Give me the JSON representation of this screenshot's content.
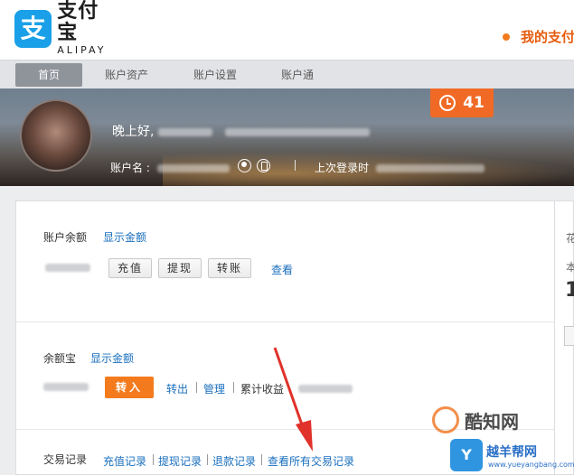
{
  "header": {
    "logo_cn": "支付宝",
    "logo_en": "ALIPAY",
    "logo_mark": "支",
    "my_link": "我的支付"
  },
  "nav": {
    "items": [
      {
        "label": "首页",
        "active": true
      },
      {
        "label": "账户资产",
        "active": false
      },
      {
        "label": "账户设置",
        "active": false
      },
      {
        "label": "账户通",
        "active": false
      }
    ]
  },
  "banner": {
    "greeting": "晚上好,",
    "account_name_label": "账户名 :",
    "last_login_label": "上次登录时",
    "alarm_count": "41"
  },
  "balance": {
    "label": "账户余额",
    "show_amount": "显示金额",
    "btn_recharge": "充值",
    "btn_withdraw": "提现",
    "btn_transfer": "转账",
    "view": "查看"
  },
  "yuebao": {
    "label": "余额宝",
    "show_amount": "显示金额",
    "btn_in": "转入",
    "out": "转出",
    "manage": "管理",
    "cumulative": "累计收益"
  },
  "records": {
    "label": "交易记录",
    "recharge": "充值记录",
    "withdraw": "提现记录",
    "refund": "退款记录",
    "all": "查看所有交易记录"
  },
  "side": {
    "text1": "花",
    "text2": "本",
    "big": "1"
  },
  "watermark": {
    "brand1": "酷知网",
    "brand2_icon": "Y",
    "brand2_title": "越羊帮网",
    "brand2_url": "www.yueyangbang.com"
  },
  "colors": {
    "accent_orange": "#f37b1d",
    "link_blue": "#1a6fbe",
    "alipay_blue": "#1aa0e8",
    "arrow_red": "#e0322a"
  }
}
